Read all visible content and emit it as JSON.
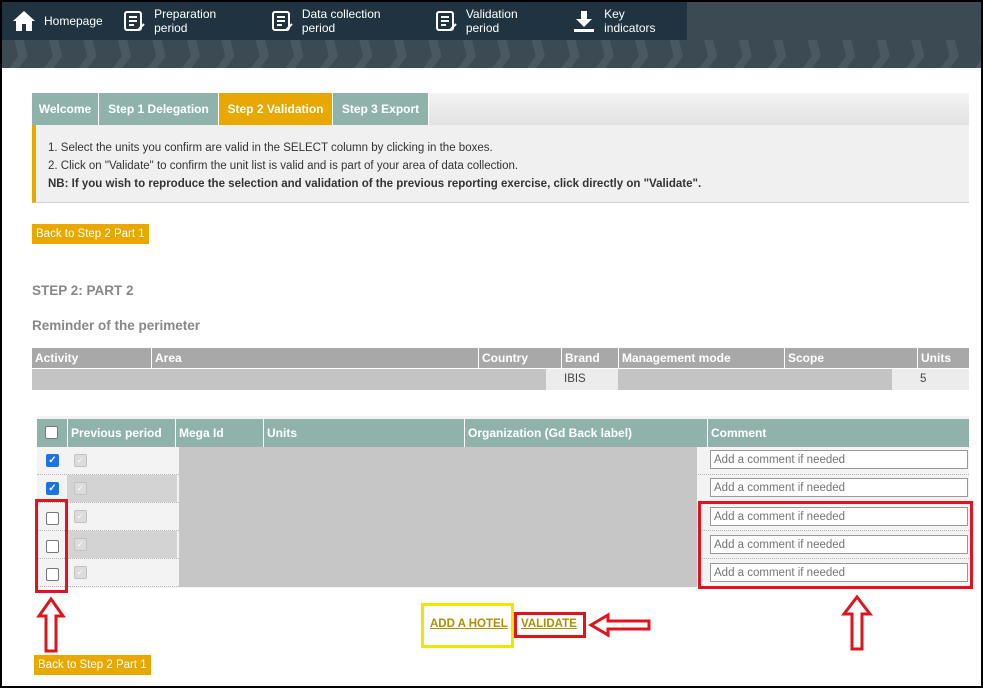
{
  "nav": {
    "items": [
      {
        "label": "Homepage",
        "icon": "home-icon"
      },
      {
        "label": "Preparation period",
        "icon": "checklist-icon"
      },
      {
        "label": "Data collection period",
        "icon": "checklist-icon"
      },
      {
        "label": "Validation period",
        "icon": "checklist-icon"
      },
      {
        "label": "Key indicators",
        "icon": "download-icon"
      }
    ]
  },
  "tabs": [
    {
      "label": "Welcome",
      "active": false
    },
    {
      "label": "Step 1 Delegation",
      "active": false
    },
    {
      "label": "Step 2 Validation",
      "active": true
    },
    {
      "label": "Step 3 Export",
      "active": false
    }
  ],
  "instructions": {
    "line1": "1. Select the units you confirm are valid in the SELECT column by clicking in the boxes.",
    "line2": "2. Click on \"Validate\" to confirm the unit list is valid and is part of your area of data collection.",
    "nb": "NB: If you wish to reproduce the selection and validation of the previous reporting exercise, click directly on \"Validate\"."
  },
  "back_button_top": "Back to Step 2 Part 1",
  "back_button_bottom": "Back to Step 2 Part 1",
  "step_title": "STEP 2: PART 2",
  "reminder_title": "Reminder of the perimeter",
  "perimeter_table": {
    "headers": [
      "Activity",
      "Area",
      "Country",
      "Brand",
      "Management mode",
      "Scope",
      "Units"
    ],
    "row": {
      "brand": "IBIS",
      "units": "5"
    }
  },
  "units_table": {
    "headers": [
      "Previous period",
      "Mega Id",
      "Units",
      "Organization (Gd Back label)",
      "Comment"
    ],
    "comment_placeholder": "Add a comment if needed",
    "rows": [
      {
        "selected": true,
        "previous": true
      },
      {
        "selected": true,
        "previous": true
      },
      {
        "selected": false,
        "previous": true
      },
      {
        "selected": false,
        "previous": true
      },
      {
        "selected": false,
        "previous": true
      }
    ]
  },
  "actions": {
    "add_hotel": "ADD A HOTEL",
    "validate": "VALIDATE"
  },
  "colors": {
    "nav_bg": "#1f3340",
    "tab_inactive": "#8fb3aa",
    "tab_active": "#e8a800",
    "highlight_red": "#e1141d",
    "highlight_yellow": "#f2e600"
  }
}
